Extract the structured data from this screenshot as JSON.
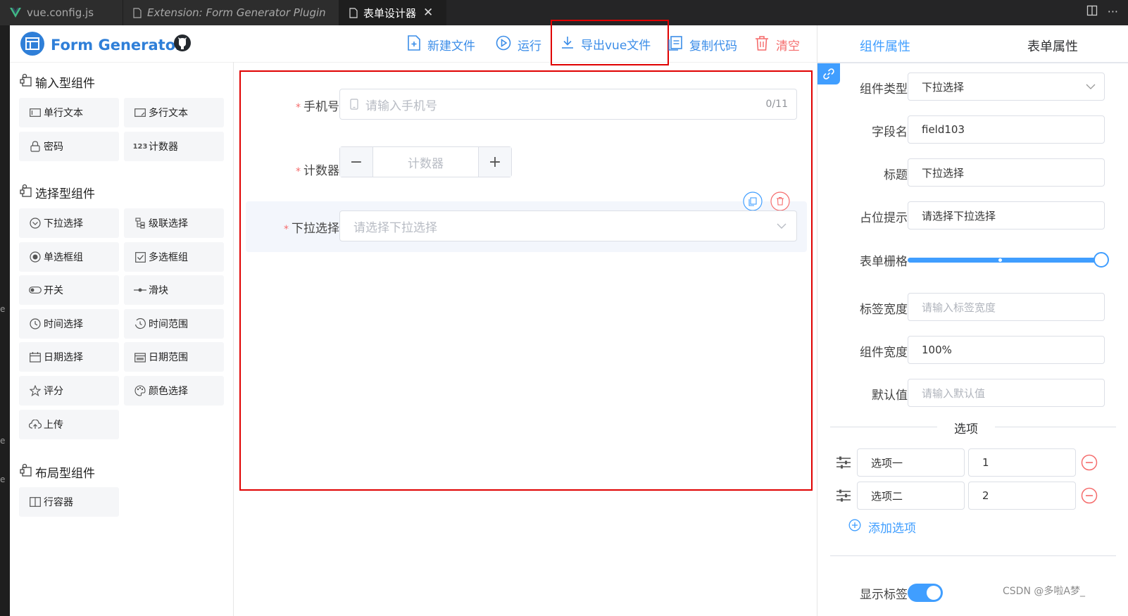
{
  "tabs": [
    {
      "label": "vue.config.js"
    },
    {
      "label": "Extension: Form Generator Plugin"
    },
    {
      "label": "表单设计器"
    }
  ],
  "edge_letters": [
    "e",
    "e",
    "e"
  ],
  "app": {
    "title": "Form Generator"
  },
  "toolbar": {
    "new_file": "新建文件",
    "run": "运行",
    "export_vue": "导出vue文件",
    "copy_code": "复制代码",
    "clear": "清空"
  },
  "groups": {
    "input": {
      "title": "输入型组件",
      "items": [
        {
          "label": "单行文本",
          "icon": "input-icon"
        },
        {
          "label": "多行文本",
          "icon": "textarea-icon"
        },
        {
          "label": "密码",
          "icon": "lock-icon"
        },
        {
          "label": "计数器",
          "icon": "number-icon"
        }
      ]
    },
    "select": {
      "title": "选择型组件",
      "items": [
        {
          "label": "下拉选择",
          "icon": "select-icon"
        },
        {
          "label": "级联选择",
          "icon": "cascader-icon"
        },
        {
          "label": "单选框组",
          "icon": "radio-icon"
        },
        {
          "label": "多选框组",
          "icon": "checkbox-icon"
        },
        {
          "label": "开关",
          "icon": "switch-icon"
        },
        {
          "label": "滑块",
          "icon": "slider-icon"
        },
        {
          "label": "时间选择",
          "icon": "clock-icon"
        },
        {
          "label": "时间范围",
          "icon": "time-range-icon"
        },
        {
          "label": "日期选择",
          "icon": "calendar-icon"
        },
        {
          "label": "日期范围",
          "icon": "date-range-icon"
        },
        {
          "label": "评分",
          "icon": "star-icon"
        },
        {
          "label": "颜色选择",
          "icon": "palette-icon"
        },
        {
          "label": "上传",
          "icon": "upload-icon"
        }
      ]
    },
    "layout": {
      "title": "布局型组件",
      "items": [
        {
          "label": "行容器",
          "icon": "row-icon"
        }
      ]
    }
  },
  "form": {
    "phone": {
      "label": "手机号",
      "placeholder": "请输入手机号",
      "counter": "0/11"
    },
    "counter": {
      "label": "计数器",
      "placeholder": "计数器"
    },
    "select": {
      "label": "下拉选择",
      "placeholder": "请选择下拉选择"
    }
  },
  "panel": {
    "tabs": {
      "component": "组件属性",
      "form": "表单属性"
    },
    "fields": {
      "type": {
        "label": "组件类型",
        "value": "下拉选择"
      },
      "field": {
        "label": "字段名",
        "value": "field103"
      },
      "title": {
        "label": "标题",
        "value": "下拉选择"
      },
      "placeholder": {
        "label": "占位提示",
        "value": "请选择下拉选择"
      },
      "grid": {
        "label": "表单栅格"
      },
      "label_width": {
        "label": "标签宽度",
        "placeholder": "请输入标签宽度"
      },
      "width": {
        "label": "组件宽度",
        "value": "100%"
      },
      "default": {
        "label": "默认值",
        "placeholder": "请输入默认值"
      }
    },
    "options_title": "选项",
    "options": [
      {
        "label": "选项一",
        "value": "1"
      },
      {
        "label": "选项二",
        "value": "2"
      }
    ],
    "add_option": "添加选项",
    "show_label": "显示标签"
  },
  "watermark": "CSDN @多啦A梦_",
  "colors": {
    "accent": "#409eff",
    "danger": "#f56c6c",
    "highlight": "#e00000"
  }
}
